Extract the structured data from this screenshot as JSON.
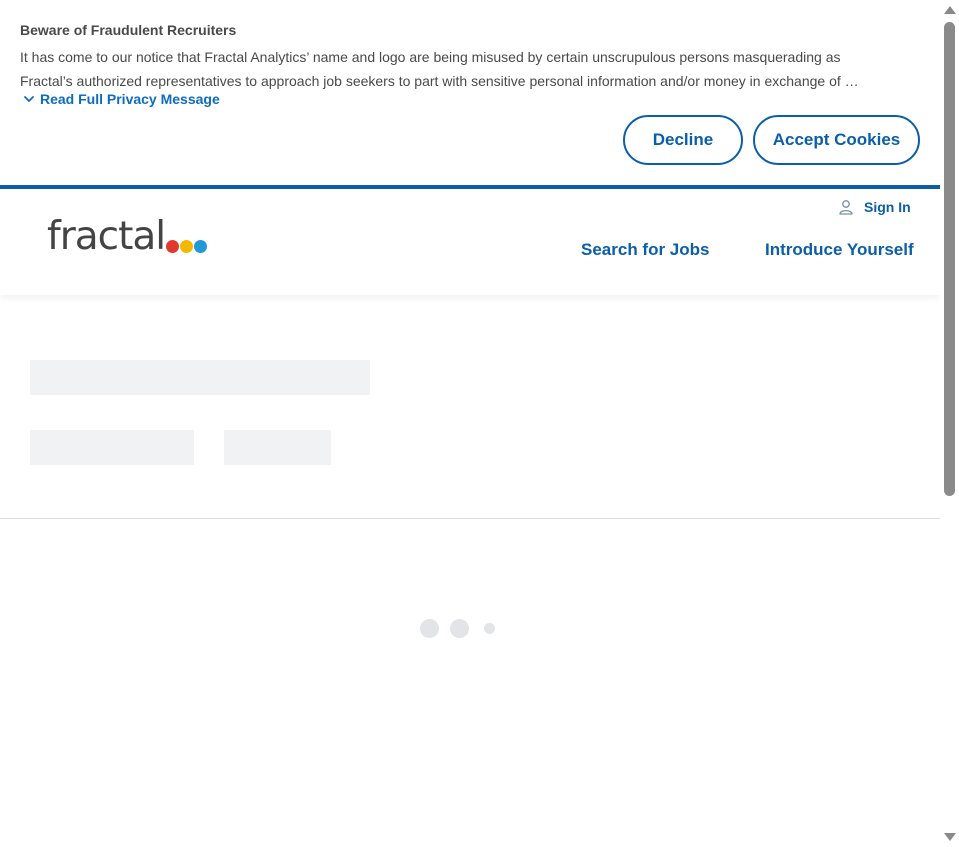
{
  "banner": {
    "title": "Beware of Fraudulent Recruiters",
    "line1": "It has come to our notice that Fractal Analytics’ name and logo are being misused by certain unscrupulous persons masquerading as",
    "line2": "Fractal’s authorized representatives to approach job seekers to part with sensitive personal information and/or money in exchange of …",
    "read_more": "Read Full Privacy Message",
    "read_more_icon": "chevron-down-icon",
    "decline": "Decline",
    "accept": "Accept Cookies"
  },
  "header": {
    "logo_text": "fractal",
    "logo_dot_colors": [
      "#e03a2f",
      "#f5b800",
      "#1f9ad6"
    ],
    "sign_in": "Sign In",
    "sign_in_icon": "user-icon",
    "nav": {
      "search_jobs": "Search for Jobs",
      "introduce": "Introduce Yourself"
    }
  },
  "colors": {
    "accent": "#0b5ea8",
    "skeleton": "#f1f2f4"
  }
}
